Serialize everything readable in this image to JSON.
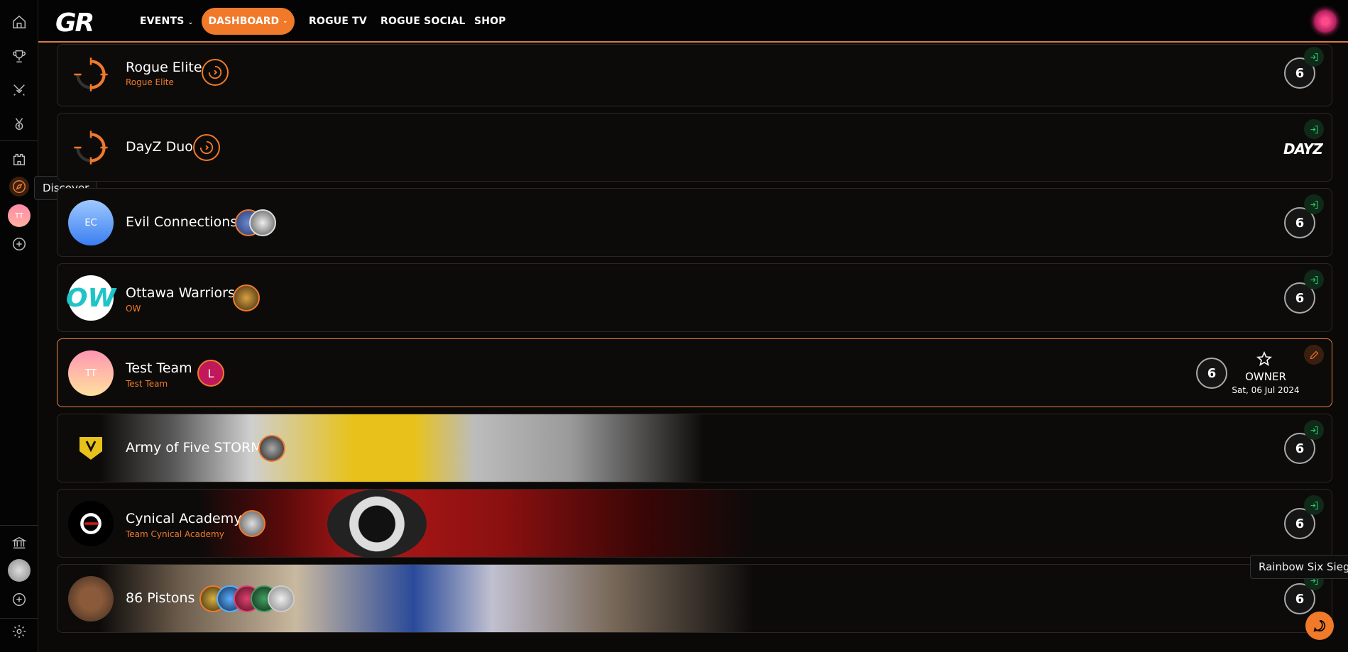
{
  "nav": {
    "logo": "GR",
    "events": "EVENTS",
    "dashboard": "DASHBOARD",
    "rogue_tv": "ROGUE TV",
    "rogue_social": "ROGUE SOCIAL",
    "shop": "SHOP"
  },
  "sidebar": {
    "tooltip": "Discover",
    "team_avatar_initials": "TT"
  },
  "tooltips": {
    "game": "Rainbow Six Siege"
  },
  "teams": [
    {
      "name": "Rogue Elite",
      "tag": "Rogue Elite",
      "game": "Rainbow Six Siege"
    },
    {
      "name": "DayZ Duo",
      "tag": "",
      "game": "DAYZ"
    },
    {
      "name": "Evil Connections",
      "tag": "",
      "initials": "EC",
      "game": "Rainbow Six Siege"
    },
    {
      "name": "Ottawa Warriors",
      "tag": "OW",
      "initials": "OW",
      "game": "Rainbow Six Siege"
    },
    {
      "name": "Test Team",
      "tag": "Test Team",
      "initials": "TT",
      "member_initial": "L",
      "game": "Rainbow Six Siege",
      "role": "OWNER",
      "date": "Sat, 06 Jul 2024"
    },
    {
      "name": "Army of Five STORM",
      "tag": "",
      "game": "Rainbow Six Siege"
    },
    {
      "name": "Cynical Academy",
      "tag": "Team Cynical Academy",
      "game": "Rainbow Six Siege"
    },
    {
      "name": "86 Pistons",
      "tag": "",
      "game": "Rainbow Six Siege"
    }
  ],
  "colors": {
    "accent": "#f07a2a",
    "join_green": "#29c46a",
    "background": "#0b0908"
  }
}
